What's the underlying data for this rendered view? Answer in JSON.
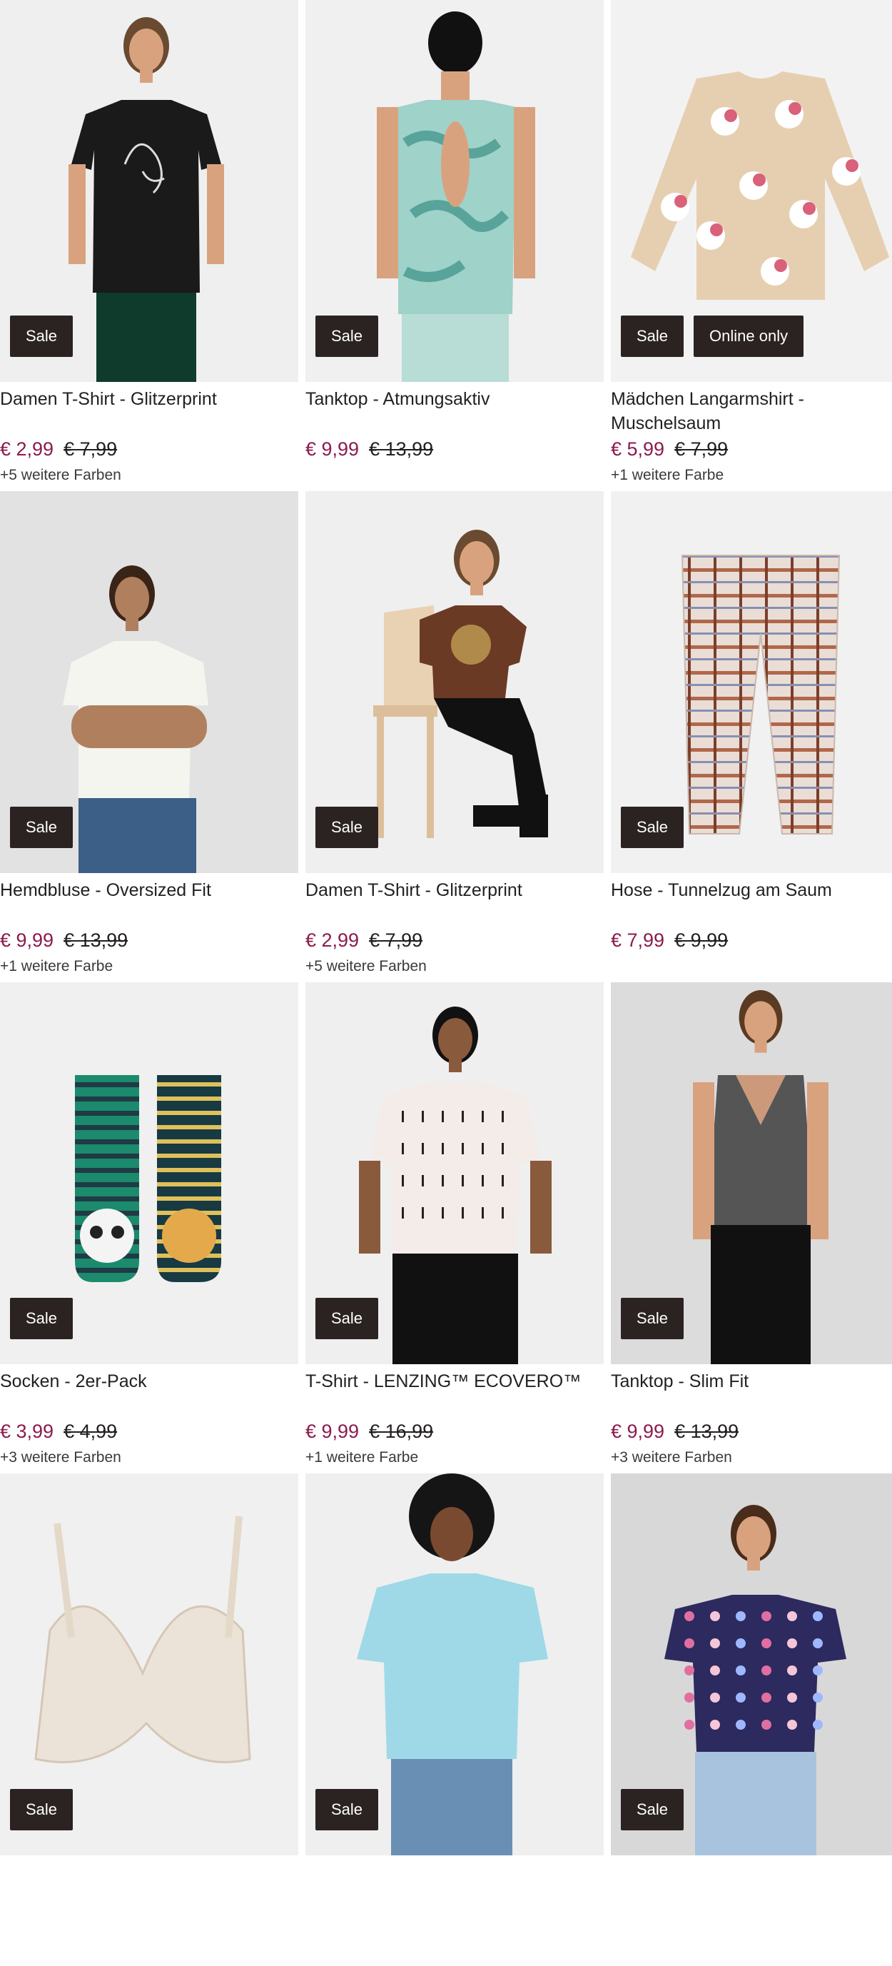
{
  "products": [
    {
      "name": "Damen T-Shirt - Glitzerprint",
      "price": "€ 2,99",
      "old_price": "€ 7,99",
      "colors": "+5 weitere Farben",
      "badges": [
        "Sale"
      ],
      "image_icon": "product-image-black-tshirt-woman",
      "bg": "#efefef"
    },
    {
      "name": "Tanktop - Atmungsaktiv",
      "price": "€ 9,99",
      "old_price": "€ 13,99",
      "colors": "",
      "badges": [
        "Sale"
      ],
      "image_icon": "product-image-printed-tanktop-back",
      "bg": "#f0f0f0"
    },
    {
      "name": "Mädchen Langarmshirt - Muschelsaum",
      "price": "€ 5,99",
      "old_price": "€ 7,99",
      "colors": "+1 weitere Farbe",
      "badges": [
        "Sale",
        "Online only"
      ],
      "image_icon": "product-image-unicorn-longsleeve",
      "bg": "#f2f2f2"
    },
    {
      "name": "Hemdbluse - Oversized Fit",
      "price": "€ 9,99",
      "old_price": "€ 13,99",
      "colors": "+1 weitere Farbe",
      "badges": [
        "Sale"
      ],
      "image_icon": "product-image-white-blouse-woman",
      "bg": "#e2e2e2"
    },
    {
      "name": "Damen T-Shirt - Glitzerprint",
      "price": "€ 2,99",
      "old_price": "€ 7,99",
      "colors": "+5 weitere Farben",
      "badges": [
        "Sale"
      ],
      "image_icon": "product-image-brown-tshirt-woman-chair",
      "bg": "#efefef"
    },
    {
      "name": "Hose - Tunnelzug am Saum",
      "price": "€ 7,99",
      "old_price": "€ 9,99",
      "colors": "",
      "badges": [
        "Sale"
      ],
      "image_icon": "product-image-checked-trousers",
      "bg": "#f1f1f1"
    },
    {
      "name": "Socken - 2er-Pack",
      "price": "€ 3,99",
      "old_price": "€ 4,99",
      "colors": "+3 weitere Farben",
      "badges": [
        "Sale"
      ],
      "image_icon": "product-image-kids-socks-pair",
      "bg": "#f0f0f0"
    },
    {
      "name": "T-Shirt - LENZING™ ECOVERO™",
      "price": "€ 9,99",
      "old_price": "€ 16,99",
      "colors": "+1 weitere Farbe",
      "badges": [
        "Sale"
      ],
      "image_icon": "product-image-white-tshirt-woman",
      "bg": "#efefef"
    },
    {
      "name": "Tanktop - Slim Fit",
      "price": "€ 9,99",
      "old_price": "€ 13,99",
      "colors": "+3 weitere Farben",
      "badges": [
        "Sale"
      ],
      "image_icon": "product-image-grey-tanktop-woman",
      "bg": "#dcdcdc"
    },
    {
      "name": "",
      "price": "",
      "old_price": "",
      "colors": "",
      "badges": [
        "Sale"
      ],
      "image_icon": "product-image-lace-bra",
      "bg": "#f0f0f0"
    },
    {
      "name": "",
      "price": "",
      "old_price": "",
      "colors": "",
      "badges": [
        "Sale"
      ],
      "image_icon": "product-image-lightblue-tshirt-woman",
      "bg": "#efefef"
    },
    {
      "name": "",
      "price": "",
      "old_price": "",
      "colors": "",
      "badges": [
        "Sale"
      ],
      "image_icon": "product-image-floral-blouse-woman",
      "bg": "#d8d8d8"
    }
  ]
}
